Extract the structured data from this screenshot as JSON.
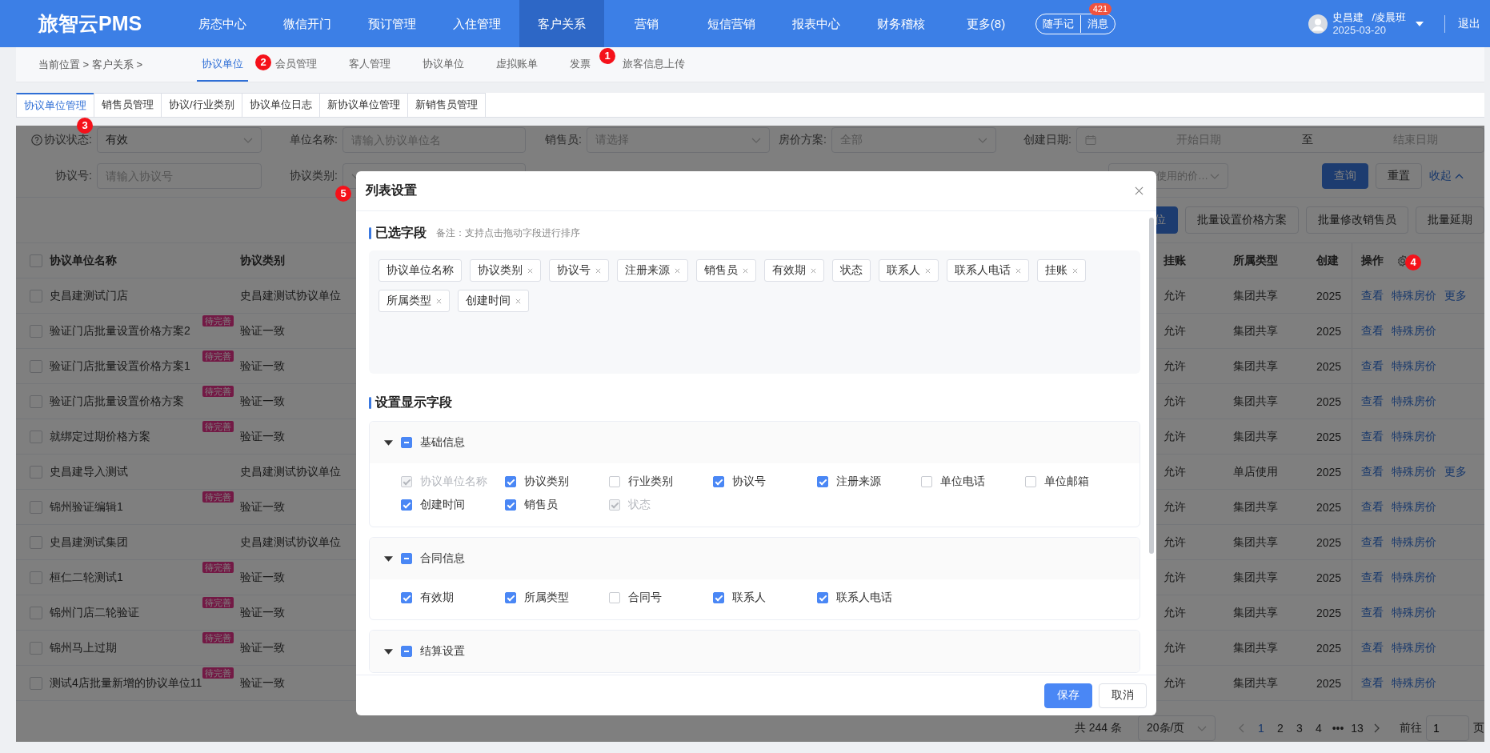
{
  "nav": {
    "logo": "旅智云PMS",
    "items": [
      {
        "label": "房态中心",
        "selected": false
      },
      {
        "label": "微信开门",
        "selected": false
      },
      {
        "label": "预订管理",
        "selected": false
      },
      {
        "label": "入住管理",
        "selected": false
      },
      {
        "label": "客户关系",
        "selected": true
      },
      {
        "label": "营销",
        "selected": false
      },
      {
        "label": "短信营销",
        "selected": false
      },
      {
        "label": "报表中心",
        "selected": false
      },
      {
        "label": "财务稽核",
        "selected": false
      },
      {
        "label": "更多(8)",
        "selected": false
      }
    ],
    "quick_note": "随手记",
    "messages": "消息",
    "message_count": "421",
    "user": {
      "name": "史昌建",
      "shift": "/凌晨班",
      "date": "2025-03-20"
    },
    "logout": "退出"
  },
  "breadcrumb": "当前位置 > 客户关系 >",
  "module_tabs": [
    {
      "label": "协议单位",
      "selected": true
    },
    {
      "label": "会员管理",
      "selected": false
    },
    {
      "label": "客人管理",
      "selected": false
    },
    {
      "label": "协议单位",
      "selected": false
    },
    {
      "label": "虚拟账单",
      "selected": false
    },
    {
      "label": "发票",
      "selected": false
    },
    {
      "label": "旅客信息上传",
      "selected": false
    }
  ],
  "page_tabs": [
    {
      "label": "协议单位管理",
      "selected": true
    },
    {
      "label": "销售员管理",
      "selected": false
    },
    {
      "label": "协议/行业类别",
      "selected": false
    },
    {
      "label": "协议单位日志",
      "selected": false
    },
    {
      "label": "新协议单位管理",
      "selected": false
    },
    {
      "label": "新销售员管理",
      "selected": false
    }
  ],
  "filter_rows": [
    [
      {
        "label": "协议状态:",
        "help": true,
        "kind": "select",
        "value": "有效"
      },
      {
        "label": "单位名称:",
        "kind": "input",
        "placeholder": "请输入协议单位名"
      },
      {
        "label": "销售员:",
        "kind": "select",
        "placeholder": "请选择"
      },
      {
        "label": "房价方案:",
        "kind": "select",
        "placeholder": "全部"
      },
      {
        "label": "创建日期:",
        "kind": "daterange",
        "start_placeholder": "开始日期",
        "separator": "至",
        "end_placeholder": "结束日期"
      }
    ],
    [
      {
        "label": "协议号:",
        "kind": "input",
        "placeholder": "请输入协议号"
      },
      {
        "label": "协议类别:",
        "kind": "select"
      },
      {
        "kind": "select",
        "placeholder": "使用的价…"
      }
    ]
  ],
  "filter_actions": {
    "search": "查询",
    "reset": "重置",
    "collapse": "收起"
  },
  "batch_buttons": [
    {
      "label": "位",
      "primary": true
    },
    {
      "label": "批量设置价格方案",
      "primary": false
    },
    {
      "label": "批量修改销售员",
      "primary": false
    },
    {
      "label": "批量延期",
      "primary": false
    }
  ],
  "table": {
    "all_checked": false,
    "columns": [
      "协议单位名称",
      "协议类别",
      "挂账",
      "所属类型",
      "创建",
      "操作"
    ],
    "rows": [
      {
        "checked": false,
        "name": "史昌建测试门店",
        "type": "史昌建测试协议单位",
        "credit": "允许",
        "scope": "集团共享",
        "created": "2025",
        "actions": [
          "查看",
          "特殊房价",
          "更多"
        ]
      },
      {
        "checked": false,
        "name": "验证门店批量设置价格方案2",
        "tag": "待完善",
        "type": "验证一致",
        "credit": "允许",
        "scope": "集团共享",
        "created": "2025",
        "actions": [
          "查看",
          "特殊房价"
        ]
      },
      {
        "checked": false,
        "name": "验证门店批量设置价格方案1",
        "tag": "待完善",
        "type": "验证一致",
        "credit": "允许",
        "scope": "集团共享",
        "created": "2025",
        "actions": [
          "查看",
          "特殊房价"
        ]
      },
      {
        "checked": false,
        "name": "验证门店批量设置价格方案",
        "tag": "待完善",
        "type": "验证一致",
        "credit": "允许",
        "scope": "集团共享",
        "created": "2025",
        "actions": [
          "查看",
          "特殊房价"
        ]
      },
      {
        "checked": false,
        "name": "就绑定过期价格方案",
        "tag": "待完善",
        "type": "验证一致",
        "credit": "允许",
        "scope": "集团共享",
        "created": "2025",
        "actions": [
          "查看",
          "特殊房价"
        ]
      },
      {
        "checked": false,
        "name": "史昌建导入测试",
        "type": "史昌建测试协议单位",
        "credit": "允许",
        "scope": "单店使用",
        "created": "2025",
        "actions": [
          "查看",
          "特殊房价",
          "更多"
        ]
      },
      {
        "checked": false,
        "name": "锦州验证编辑1",
        "tag": "待完善",
        "type": "验证一致",
        "credit": "允许",
        "scope": "集团共享",
        "created": "2025",
        "actions": [
          "查看",
          "特殊房价"
        ]
      },
      {
        "checked": false,
        "name": "史昌建测试集团",
        "type": "史昌建测试协议单位",
        "credit": "允许",
        "scope": "集团共享",
        "created": "2025",
        "actions": [
          "查看",
          "特殊房价"
        ]
      },
      {
        "checked": false,
        "name": "桓仁二轮测试1",
        "tag": "待完善",
        "type": "验证一致",
        "credit": "允许",
        "scope": "集团共享",
        "created": "2025",
        "actions": [
          "查看",
          "特殊房价"
        ]
      },
      {
        "checked": false,
        "name": "锦州门店二轮验证",
        "tag": "待完善",
        "type": "验证一致",
        "credit": "允许",
        "scope": "集团共享",
        "created": "2025",
        "actions": [
          "查看",
          "特殊房价"
        ]
      },
      {
        "checked": false,
        "name": "锦州马上过期",
        "tag": "待完善",
        "type": "验证一致",
        "credit": "允许",
        "scope": "集团共享",
        "created": "2025",
        "actions": [
          "查看",
          "特殊房价"
        ]
      },
      {
        "checked": false,
        "name": "测试4店批量新增的协议单位11",
        "tag": "待完善",
        "type": "验证一致",
        "credit": "允许",
        "scope": "集团共享",
        "created": "2025",
        "actions": [
          "查看",
          "特殊房价"
        ]
      }
    ]
  },
  "pagination": {
    "total": "共 244 条",
    "page_size": "20条/页",
    "pages": [
      {
        "label": "1",
        "selected": true
      },
      {
        "label": "2",
        "selected": false
      },
      {
        "label": "3",
        "selected": false
      },
      {
        "label": "4",
        "selected": false
      },
      {
        "label": "•••",
        "selected": false
      },
      {
        "label": "13",
        "selected": false
      }
    ],
    "goto": "前往",
    "goto_value": "1",
    "page_suffix": "页"
  },
  "modal": {
    "title": "列表设置",
    "selected_title": "已选字段",
    "selected_note": "备注：支持点击拖动字段进行排序",
    "chips": [
      {
        "label": "协议单位名称",
        "removable": false
      },
      {
        "label": "协议类别",
        "removable": true
      },
      {
        "label": "协议号",
        "removable": true
      },
      {
        "label": "注册来源",
        "removable": true
      },
      {
        "label": "销售员",
        "removable": true
      },
      {
        "label": "有效期",
        "removable": true
      },
      {
        "label": "状态",
        "removable": false
      },
      {
        "label": "联系人",
        "removable": true
      },
      {
        "label": "联系人电话",
        "removable": true
      },
      {
        "label": "挂账",
        "removable": true
      },
      {
        "label": "所属类型",
        "removable": true
      },
      {
        "label": "创建时间",
        "removable": true
      }
    ],
    "display_title": "设置显示字段",
    "groups": [
      {
        "title": "基础信息",
        "expanded": true,
        "indeterminate": true,
        "fields": [
          {
            "label": "协议单位名称",
            "checked": true,
            "disabled": true
          },
          {
            "label": "协议类别",
            "checked": true,
            "disabled": false
          },
          {
            "label": "行业类别",
            "checked": false,
            "disabled": false
          },
          {
            "label": "协议号",
            "checked": true,
            "disabled": false
          },
          {
            "label": "注册来源",
            "checked": true,
            "disabled": false
          },
          {
            "label": "单位电话",
            "checked": false,
            "disabled": false
          },
          {
            "label": "单位邮箱",
            "checked": false,
            "disabled": false
          },
          {
            "label": "创建时间",
            "checked": true,
            "disabled": false
          },
          {
            "label": "销售员",
            "checked": true,
            "disabled": false
          },
          {
            "label": "状态",
            "checked": true,
            "disabled": true
          }
        ]
      },
      {
        "title": "合同信息",
        "expanded": true,
        "indeterminate": true,
        "fields": [
          {
            "label": "有效期",
            "checked": true,
            "disabled": false
          },
          {
            "label": "所属类型",
            "checked": true,
            "disabled": false
          },
          {
            "label": "合同号",
            "checked": false,
            "disabled": false
          },
          {
            "label": "联系人",
            "checked": true,
            "disabled": false
          },
          {
            "label": "联系人电话",
            "checked": true,
            "disabled": false
          }
        ]
      },
      {
        "title": "结算设置",
        "expanded": true,
        "indeterminate": true
      }
    ],
    "buttons": [
      {
        "label": "保存",
        "primary": true
      },
      {
        "label": "取消",
        "primary": false
      }
    ]
  },
  "annotations": [
    {
      "label": "1"
    },
    {
      "label": "2"
    },
    {
      "label": "3"
    },
    {
      "label": "4"
    },
    {
      "label": "5"
    }
  ]
}
